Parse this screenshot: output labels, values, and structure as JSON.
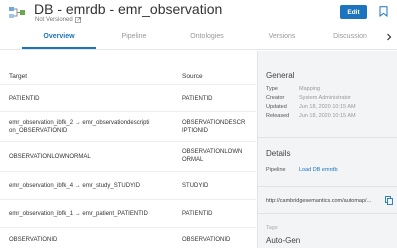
{
  "header": {
    "title": "DB - emrdb - emr_observation",
    "version_status": "Not Versioned",
    "edit_label": "Edit"
  },
  "tabs": [
    {
      "label": "Overview",
      "active": true
    },
    {
      "label": "Pipeline",
      "active": false
    },
    {
      "label": "Ontologies",
      "active": false
    },
    {
      "label": "Versions",
      "active": false
    },
    {
      "label": "Discussion",
      "active": false
    }
  ],
  "table": {
    "columns": [
      "Target",
      "Source"
    ],
    "rows": [
      {
        "target": "PATIENTID",
        "source": "PATIENTID"
      },
      {
        "target": "emr_observation_ibfk_2 → emr_observationdescripti on_OBSERVATIONID",
        "source": "OBSERVATIONDESCR IPTIONID"
      },
      {
        "target": "OBSERVATIONLOWNORMAL",
        "source": "OBSERVATIONLOWN ORMAL"
      },
      {
        "target": "emr_observation_ibfk_4 → emr_study_STUDYID",
        "source": "STUDYID"
      },
      {
        "target": "emr_observation_ibfk_1 → emr_patient_PATIENTID",
        "source": "PATIENTID"
      },
      {
        "target": "OBSERVATIONID",
        "source": "OBSERVATIONID"
      }
    ]
  },
  "general": {
    "heading": "General",
    "fields": [
      {
        "key": "Type",
        "value": "Mapping"
      },
      {
        "key": "Creator",
        "value": "System Administrator"
      },
      {
        "key": "Updated",
        "value": "Jun 18, 2020 10:15 AM"
      },
      {
        "key": "Released",
        "value": "Jun 18, 2020 10:15 AM"
      }
    ]
  },
  "details": {
    "heading": "Details",
    "pipeline_key": "Pipeline",
    "pipeline_value": "Load DB emrdb"
  },
  "uri": "http://cambridgesemantics.com/automap/...",
  "tags": {
    "label": "Tags",
    "value": "Auto-Gen"
  },
  "colors": {
    "accent": "#1c75bc",
    "panel_bg": "#f3f4f6"
  }
}
